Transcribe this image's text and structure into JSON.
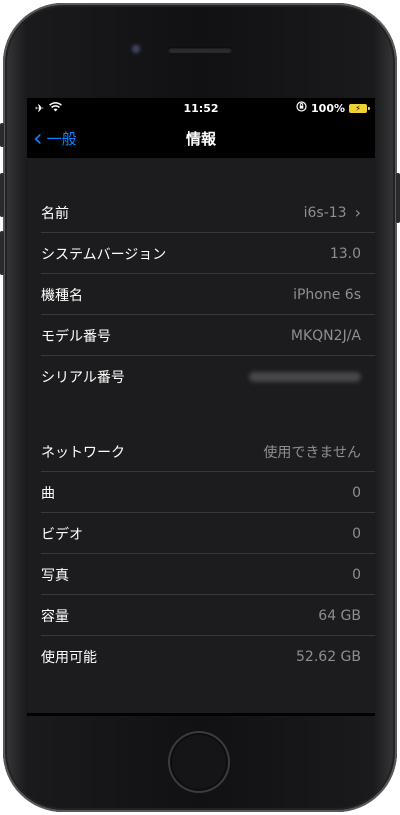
{
  "status_bar": {
    "time": "11:52",
    "battery_percent": "100%",
    "icons": [
      "airplane-icon",
      "wifi-icon",
      "orientation-lock-icon",
      "battery-charging-icon"
    ]
  },
  "nav": {
    "back_label": "一般",
    "title": "情報"
  },
  "section1": {
    "rows": [
      {
        "label": "名前",
        "value": "i6s-13",
        "chevron": true
      },
      {
        "label": "システムバージョン",
        "value": "13.0"
      },
      {
        "label": "機種名",
        "value": "iPhone 6s"
      },
      {
        "label": "モデル番号",
        "value": "MKQN2J/A"
      },
      {
        "label": "シリアル番号",
        "value": ""
      }
    ]
  },
  "section2": {
    "rows": [
      {
        "label": "ネットワーク",
        "value": "使用できません"
      },
      {
        "label": "曲",
        "value": "0"
      },
      {
        "label": "ビデオ",
        "value": "0"
      },
      {
        "label": "写真",
        "value": "0"
      },
      {
        "label": "容量",
        "value": "64 GB"
      },
      {
        "label": "使用可能",
        "value": "52.62 GB"
      }
    ]
  },
  "colors": {
    "accent": "#0a84ff",
    "battery": "#f2d230",
    "cell_bg": "#1c1c1e",
    "secondary_text": "#8e8e93"
  }
}
